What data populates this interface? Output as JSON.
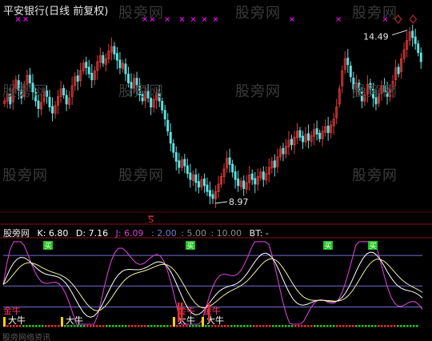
{
  "window": {
    "title": "平安银行(日线 前复权)"
  },
  "watermarks": [
    "股旁网",
    "股旁网",
    "股旁网",
    "股旁网",
    "股旁网",
    "股旁网",
    "股旁网",
    "股旁网",
    "股旁网",
    "股旁网"
  ],
  "footer": "股旁网络资讯",
  "colors": {
    "background": "#000000",
    "candle_up": "#e03a3a",
    "candle_down": "#5fe0e0",
    "K": "#ffffff",
    "D": "#f0f0a0",
    "J": "#d040d0",
    "level_line": "#7070d0",
    "signal_green": "#22c322",
    "signal_red": "#e03030",
    "signal_yellow": "#ffd400",
    "marker": "#ff00ff"
  },
  "indicator_header": {
    "name": "股旁网",
    "k_label": "K:",
    "k_value": "6.80",
    "d_label": "D:",
    "d_value": "7.16",
    "j_label": "J:",
    "j_value": "6.09",
    "levels": [
      ": 2.00",
      ": 5.00",
      ": 10.00"
    ],
    "bt_label": "BT: -"
  },
  "chart_data": [
    {
      "type": "candlestick",
      "title": "平安银行(日线 前复权)",
      "annotations": [
        {
          "text": "14.49",
          "kind": "high"
        },
        {
          "text": "8.97",
          "kind": "low"
        },
        {
          "text": "S",
          "kind": "signal"
        }
      ],
      "x_markers": [
        {
          "day": 8
        },
        {
          "day": 12
        },
        {
          "day": 76
        },
        {
          "day": 80
        },
        {
          "day": 88
        },
        {
          "day": 96
        },
        {
          "day": 102
        },
        {
          "day": 108
        },
        {
          "day": 114
        },
        {
          "day": 155
        },
        {
          "day": 180
        },
        {
          "day": 205
        }
      ],
      "diamonds": [
        {
          "day": 212
        },
        {
          "day": 220
        }
      ],
      "close": [
        12.2,
        12.45,
        12.1,
        12.6,
        12.9,
        12.55,
        12.3,
        12.75,
        13.05,
        12.8,
        12.5,
        12.2,
        11.95,
        12.15,
        12.5,
        12.35,
        12.0,
        11.8,
        12.05,
        12.35,
        12.6,
        12.4,
        12.1,
        12.3,
        12.7,
        13.0,
        12.85,
        13.2,
        13.45,
        13.3,
        13.1,
        12.9,
        13.2,
        13.5,
        13.7,
        13.45,
        13.6,
        13.85,
        14.0,
        13.75,
        13.55,
        13.3,
        13.45,
        13.1,
        12.8,
        12.6,
        12.95,
        12.7,
        12.4,
        12.2,
        12.5,
        12.3,
        12.0,
        12.25,
        12.45,
        12.2,
        11.9,
        11.6,
        11.2,
        10.8,
        10.5,
        10.2,
        10.0,
        10.25,
        10.05,
        9.8,
        9.6,
        9.75,
        9.5,
        9.35,
        9.6,
        9.4,
        9.2,
        9.05,
        8.97,
        9.2,
        9.45,
        9.7,
        9.95,
        10.3,
        10.1,
        9.85,
        9.6,
        9.4,
        9.55,
        9.3,
        9.5,
        9.75,
        9.6,
        9.45,
        9.7,
        9.85,
        9.6,
        9.8,
        10.0,
        10.2,
        10.0,
        10.35,
        10.6,
        10.45,
        10.7,
        10.9,
        10.75,
        11.0,
        11.2,
        11.0,
        10.85,
        11.1,
        10.9,
        11.05,
        11.25,
        11.1,
        10.95,
        11.2,
        11.35,
        11.15,
        11.4,
        11.6,
        12.0,
        12.6,
        13.2,
        13.6,
        13.4,
        13.0,
        12.6,
        12.8,
        12.5,
        12.2,
        12.4,
        12.75,
        12.6,
        12.3,
        12.1,
        12.45,
        12.7,
        12.5,
        12.35,
        12.6,
        12.85,
        13.3,
        13.1,
        13.6,
        13.9,
        14.2,
        14.49,
        14.3,
        14.1,
        13.8,
        13.5
      ],
      "up": [
        1,
        1,
        0,
        1,
        1,
        0,
        0,
        1,
        1,
        0,
        0,
        0,
        0,
        1,
        1,
        0,
        0,
        0,
        1,
        1,
        1,
        0,
        0,
        1,
        1,
        1,
        0,
        1,
        1,
        0,
        0,
        0,
        1,
        1,
        1,
        0,
        1,
        1,
        1,
        0,
        0,
        0,
        1,
        0,
        0,
        0,
        1,
        0,
        0,
        0,
        1,
        0,
        0,
        1,
        1,
        0,
        0,
        0,
        0,
        0,
        0,
        0,
        0,
        1,
        0,
        0,
        0,
        1,
        0,
        0,
        1,
        0,
        0,
        0,
        0,
        1,
        1,
        1,
        1,
        1,
        0,
        0,
        0,
        0,
        1,
        0,
        1,
        1,
        0,
        0,
        1,
        1,
        0,
        1,
        1,
        1,
        0,
        1,
        1,
        0,
        1,
        1,
        0,
        1,
        1,
        0,
        0,
        1,
        0,
        1,
        1,
        0,
        0,
        1,
        1,
        0,
        1,
        1,
        1,
        1,
        1,
        1,
        0,
        0,
        0,
        1,
        0,
        0,
        1,
        1,
        0,
        0,
        0,
        1,
        1,
        0,
        0,
        1,
        1,
        1,
        0,
        1,
        1,
        1,
        1,
        0,
        0,
        0,
        0
      ]
    },
    {
      "type": "line",
      "title": "股旁网",
      "series": [
        {
          "name": "K"
        },
        {
          "name": "D"
        },
        {
          "name": "J"
        }
      ],
      "levels": [
        2.0,
        5.0,
        10.0
      ],
      "signals": [
        {
          "label": "买",
          "color": "green"
        },
        {
          "label": "买",
          "color": "green"
        },
        {
          "label": "买",
          "color": "green"
        },
        {
          "label": "买",
          "color": "green"
        }
      ],
      "bull_labels": [
        "大牛",
        "大牛",
        "大牛",
        "大牛"
      ],
      "bear_labels": [
        "金牛",
        "金牛",
        "金牛"
      ]
    }
  ]
}
